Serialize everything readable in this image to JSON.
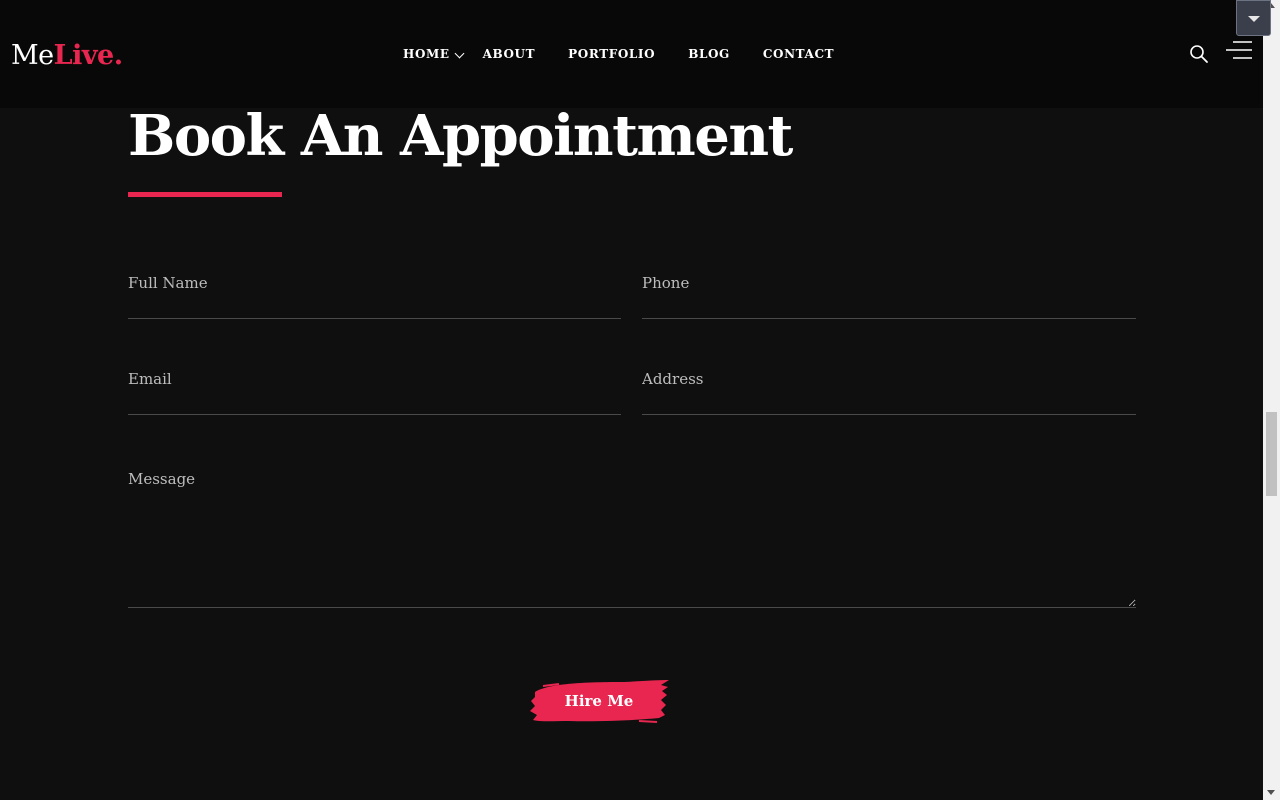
{
  "header": {
    "logo_me": "Me",
    "logo_live": "Live.",
    "nav": {
      "home": "HOME",
      "about": "ABOUT",
      "portfolio": "PORTFOLIO",
      "blog": "BLOG",
      "contact": "CONTACT"
    },
    "search_icon": "search-icon",
    "menu_icon": "hamburger-menu-icon"
  },
  "section": {
    "title": "Book An Appointment"
  },
  "form": {
    "full_name_placeholder": "Full Name",
    "phone_placeholder": "Phone",
    "email_placeholder": "Email",
    "address_placeholder": "Address",
    "message_placeholder": "Message",
    "submit_label": "Hire Me"
  },
  "colors": {
    "accent": "#e8264f",
    "background": "#0f0f10",
    "header_background": "#080808",
    "field_border": "#4a4a4a"
  }
}
